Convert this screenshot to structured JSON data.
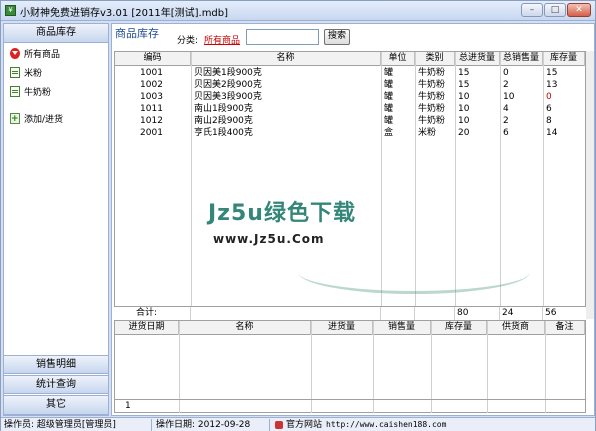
{
  "window": {
    "title": "小财神免费进销存v3.01 [2011年[测试].mdb]",
    "min": "–",
    "max": "□",
    "close": "✕"
  },
  "sidebar": {
    "header": "商品库存",
    "items": [
      {
        "label": "所有商品",
        "icon": "down-arrow-icon"
      },
      {
        "label": "米粉",
        "icon": "doc-icon"
      },
      {
        "label": "牛奶粉",
        "icon": "doc-icon"
      },
      {
        "label": "添加/进货",
        "icon": "add-icon"
      }
    ],
    "sections": [
      "销售明细",
      "统计查询",
      "其它"
    ]
  },
  "main": {
    "title": "商品库存",
    "category_label": "分类:",
    "category_value": "所有商品",
    "search_value": "",
    "search_button": "搜索"
  },
  "inventory": {
    "headers": [
      "编码",
      "名称",
      "单位",
      "类别",
      "总进货量",
      "总销售量",
      "库存量"
    ],
    "rows": [
      [
        "1001",
        "贝因美1段900克",
        "罐",
        "牛奶粉",
        "15",
        "0",
        "15"
      ],
      [
        "1002",
        "贝因美2段900克",
        "罐",
        "牛奶粉",
        "15",
        "2",
        "13"
      ],
      [
        "1003",
        "贝因美3段900克",
        "罐",
        "牛奶粉",
        "10",
        "10",
        "0"
      ],
      [
        "1011",
        "南山1段900克",
        "罐",
        "牛奶粉",
        "10",
        "4",
        "6"
      ],
      [
        "1012",
        "南山2段900克",
        "罐",
        "牛奶粉",
        "10",
        "2",
        "8"
      ],
      [
        "2001",
        "亨氏1段400克",
        "盒",
        "米粉",
        "20",
        "6",
        "14"
      ]
    ],
    "total_label": "合计:",
    "totals": {
      "in": "80",
      "sold": "24",
      "stock": "56"
    },
    "zero_stock_color": "#cc0000"
  },
  "details": {
    "headers": [
      "进货日期",
      "名称",
      "进货量",
      "销售量",
      "库存量",
      "供货商",
      "备注"
    ],
    "footer_count": "1"
  },
  "watermark": {
    "text": "Jz5u绿色下载",
    "url": "www.Jz5u.Com"
  },
  "status": {
    "operator": "操作员: 超级管理员[管理员]",
    "date": "操作日期: 2012-09-28",
    "site_label": "官方网站",
    "site_url": "http://www.caishen188.com"
  }
}
